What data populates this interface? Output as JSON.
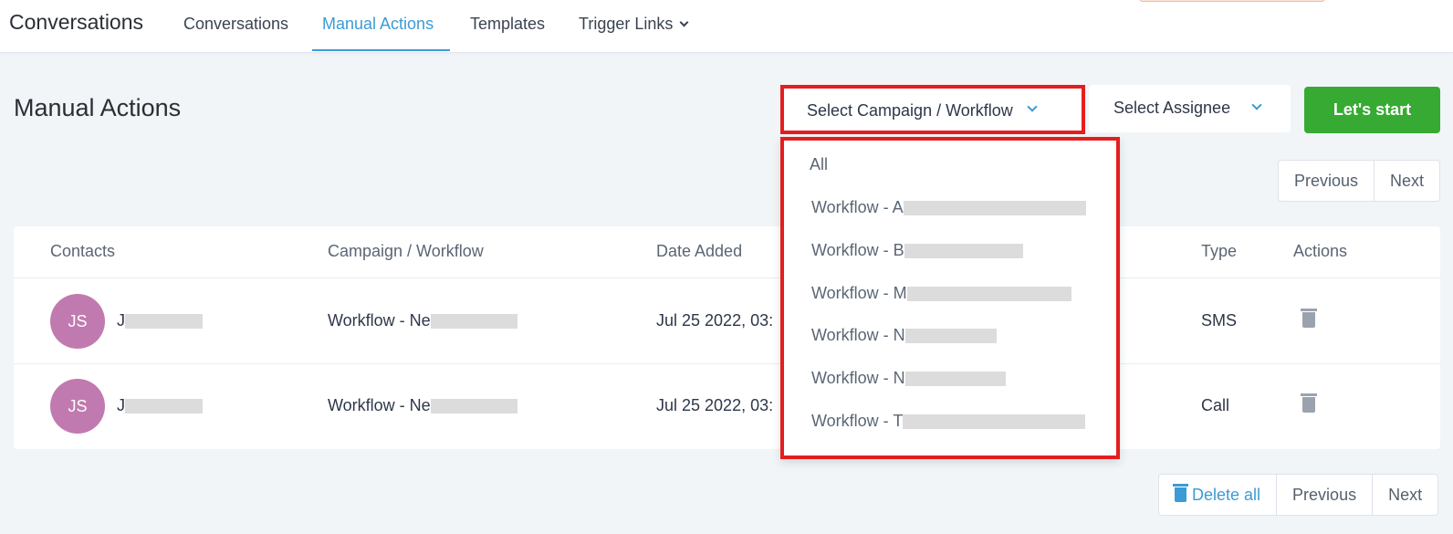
{
  "app_title": "Conversations",
  "nav": {
    "tabs": [
      {
        "label": "Conversations"
      },
      {
        "label": "Manual Actions"
      },
      {
        "label": "Templates"
      },
      {
        "label": "Trigger Links"
      }
    ],
    "active_tab": "Manual Actions"
  },
  "page": {
    "title": "Manual Actions",
    "campaign_select": "Select Campaign / Workflow",
    "assignee_select": "Select Assignee",
    "start_button": "Let's start"
  },
  "pager_top": {
    "previous": "Previous",
    "next": "Next"
  },
  "pager_bottom": {
    "delete_all": "Delete all",
    "previous": "Previous",
    "next": "Next"
  },
  "table": {
    "headers": {
      "contacts": "Contacts",
      "campaign": "Campaign / Workflow",
      "date": "Date Added",
      "type": "Type",
      "actions": "Actions"
    },
    "rows": [
      {
        "initials": "JS",
        "name": "J",
        "workflow": "Workflow - Ne",
        "date": "Jul 25 2022, 03:",
        "type": "SMS"
      },
      {
        "initials": "JS",
        "name": "J",
        "workflow": "Workflow - Ne",
        "date": "Jul 25 2022, 03:",
        "type": "Call"
      }
    ]
  },
  "dropdown": {
    "items": [
      {
        "label": "All"
      },
      {
        "label": "Workflow - A"
      },
      {
        "label": "Workflow - B"
      },
      {
        "label": "Workflow - M"
      },
      {
        "label": "Workflow - N"
      },
      {
        "label": "Workflow - N"
      },
      {
        "label": "Workflow - T"
      }
    ]
  },
  "colors": {
    "accent": "#3c9bd4",
    "start_button": "#37aa34",
    "highlight_border": "#e41e1e",
    "avatar": "#c17aaf"
  }
}
